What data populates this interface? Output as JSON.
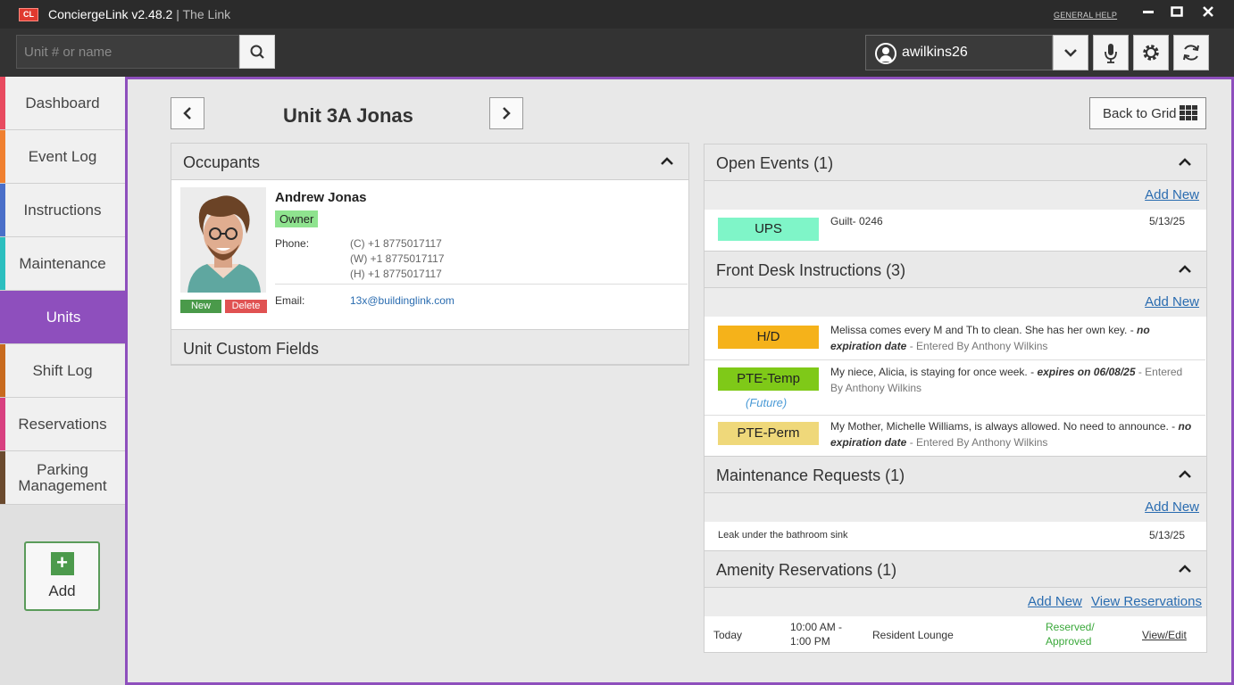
{
  "app": {
    "logo": "CL",
    "name": "ConciergeLink v2.48.2",
    "separator": " | ",
    "context": "The Link",
    "general_help": "GENERAL HELP"
  },
  "toolbar": {
    "search_placeholder": "Unit # or name",
    "username": "awilkins26"
  },
  "sidebar": {
    "items": [
      {
        "label": "Dashboard",
        "color": "#e84a5f"
      },
      {
        "label": "Event Log",
        "color": "#f08030"
      },
      {
        "label": "Instructions",
        "color": "#4a6fc9"
      },
      {
        "label": "Maintenance",
        "color": "#2cbfbf"
      },
      {
        "label": "Units",
        "color": "#8e4fbd"
      },
      {
        "label": "Shift Log",
        "color": "#c86a1e"
      },
      {
        "label": "Reservations",
        "color": "#d84080"
      },
      {
        "label": "Parking Management",
        "color": "#6b4a2e"
      }
    ],
    "add_label": "Add"
  },
  "unit": {
    "title": "Unit 3A Jonas",
    "back_to_grid": "Back to Grid"
  },
  "occupants": {
    "header": "Occupants",
    "name": "Andrew Jonas",
    "role": "Owner",
    "phone_label": "Phone:",
    "phones": [
      "(C)  +1 8775017117",
      "(W) +1 8775017117",
      "(H)  +1 8775017117"
    ],
    "email_label": "Email:",
    "email": "13x@buildinglink.com",
    "new_label": "New",
    "delete_label": "Delete",
    "custom_fields_header": "Unit Custom Fields"
  },
  "open_events": {
    "header": "Open Events (1)",
    "add_new": "Add New",
    "items": [
      {
        "tag": "UPS",
        "tag_color": "#7ff5c8",
        "text": "Guilt- 0246",
        "date": "5/13/25"
      }
    ]
  },
  "front_desk": {
    "header": "Front Desk Instructions (3)",
    "add_new": "Add New",
    "items": [
      {
        "tag": "H/D",
        "tag_color": "#f5b21a",
        "text": "Melissa comes every M and Th to clean. She has her own key.  - ",
        "bold": "no expiration date",
        "meta": " - Entered By Anthony Wilkins"
      },
      {
        "tag": "PTE-Temp",
        "tag_color": "#7fc918",
        "sub": "(Future)",
        "text": "My niece, Alicia, is staying  for once week. - ",
        "bold": "expires on 06/08/25",
        "meta": " - Entered By Anthony Wilkins"
      },
      {
        "tag": "PTE-Perm",
        "tag_color": "#efd87a",
        "text": "My Mother, Michelle Williams, is always allowed. No need to announce. - ",
        "bold": "no expiration date",
        "meta": " - Entered By Anthony Wilkins"
      }
    ]
  },
  "maintenance": {
    "header": "Maintenance Requests (1)",
    "add_new": "Add New",
    "items": [
      {
        "text": "Leak under the bathroom sink",
        "date": "5/13/25"
      }
    ]
  },
  "amenity": {
    "header": "Amenity Reservations (1)",
    "add_new": "Add New",
    "view_reservations": "View Reservations",
    "items": [
      {
        "day": "Today",
        "time_start": "10:00 AM -",
        "time_end": "1:00 PM",
        "place": "Resident Lounge",
        "status_1": "Reserved/",
        "status_2": "Approved",
        "action": "View/Edit"
      }
    ]
  }
}
